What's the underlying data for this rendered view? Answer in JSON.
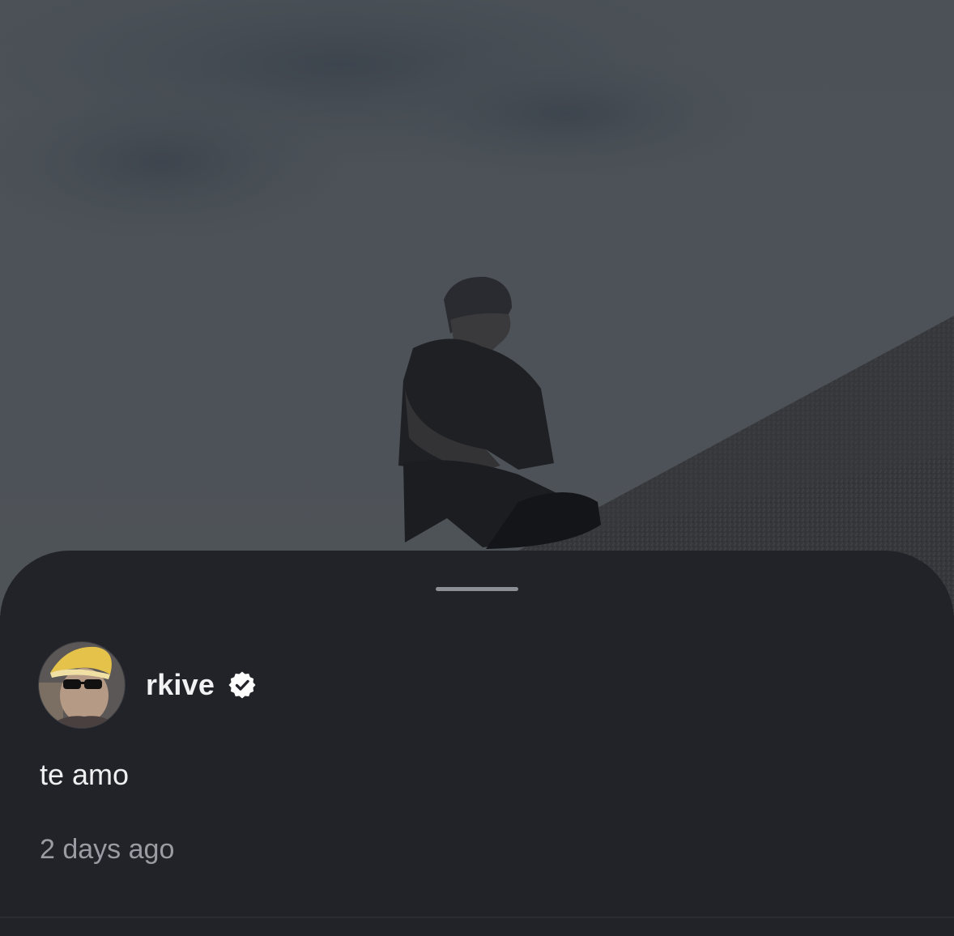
{
  "post": {
    "image_description_icon": "photo-person-sitting-on-rock"
  },
  "sheet": {
    "author": {
      "username": "rkive",
      "verified": true,
      "avatar_icon": "profile-avatar"
    },
    "comment": "te amo",
    "timestamp": "2 days ago"
  },
  "colors": {
    "sheet_bg": "#222328",
    "text_primary": "#f2f2f4",
    "text_secondary": "#9a9ca4",
    "handle": "#8c8f96"
  }
}
